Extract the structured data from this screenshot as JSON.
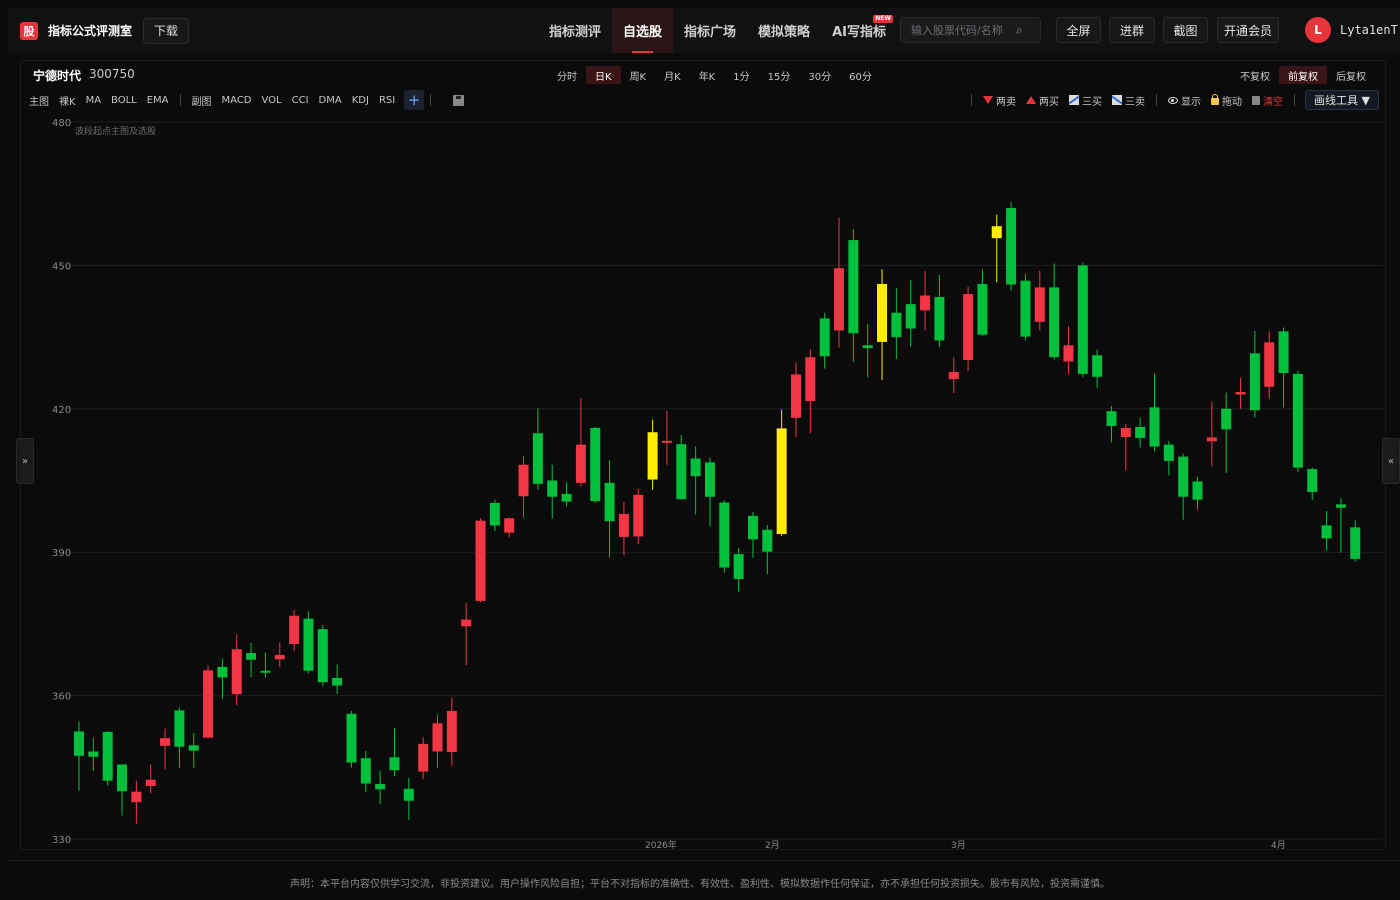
{
  "app": {
    "logo_char": "股",
    "title": "指标公式评测室",
    "download_label": "下载"
  },
  "nav": {
    "items": [
      {
        "label": "指标测评",
        "active": false
      },
      {
        "label": "自选股",
        "active": true
      },
      {
        "label": "指标广场",
        "active": false
      },
      {
        "label": "模拟策略",
        "active": false
      },
      {
        "label": "AI写指标",
        "active": false,
        "badge": "NEW"
      }
    ],
    "search_placeholder": "输入股票代码/名称",
    "buttons": {
      "fullscreen": "全屏",
      "join_group": "进群",
      "screenshot": "截图",
      "vip": "开通会员"
    },
    "avatar_letter": "L",
    "username": "Lyta1enT"
  },
  "stock": {
    "name": "宁德时代",
    "code": "300750"
  },
  "periods": [
    {
      "label": "分时",
      "active": false
    },
    {
      "label": "日K",
      "active": true
    },
    {
      "label": "周K",
      "active": false
    },
    {
      "label": "月K",
      "active": false
    },
    {
      "label": "年K",
      "active": false
    },
    {
      "label": "1分",
      "active": false
    },
    {
      "label": "15分",
      "active": false
    },
    {
      "label": "30分",
      "active": false
    },
    {
      "label": "60分",
      "active": false
    }
  ],
  "adjust": [
    {
      "label": "不复权",
      "active": false
    },
    {
      "label": "前复权",
      "active": true
    },
    {
      "label": "后复权",
      "active": false
    }
  ],
  "indicators_main": [
    "主图",
    "裸K",
    "MA",
    "BOLL",
    "EMA"
  ],
  "indicators_sub": [
    "副图",
    "MACD",
    "VOL",
    "CCI",
    "DMA",
    "KDJ",
    "RSI"
  ],
  "plus_label": "+",
  "draw_tools": {
    "sell2": "两卖",
    "buy2": "两买",
    "buy3": "三买",
    "sell3": "三卖",
    "show": "显示",
    "drag": "拖动",
    "clear": "清空",
    "menu": "画线工具 ▼"
  },
  "side_left": "»",
  "side_right": "«",
  "chart_data": {
    "type": "candlestick",
    "annotation": "波段起点主图及选股",
    "ylim": [
      330,
      480
    ],
    "yticks": [
      330,
      360,
      390,
      420,
      450,
      480
    ],
    "xticks": [
      "2026年",
      "2月",
      "3月",
      "4月"
    ],
    "colors": {
      "up": "#f23645",
      "down": "#00c03c",
      "signal": "#ffee00",
      "grid": "#1f1f22",
      "axis_text": "#8a8a8e"
    },
    "candles": [
      {
        "o": 352.5,
        "c": 347.4,
        "h": 354.6,
        "l": 340.1,
        "kind": "down"
      },
      {
        "o": 348.3,
        "c": 347.2,
        "h": 351.2,
        "l": 344.2,
        "kind": "down"
      },
      {
        "o": 352.4,
        "c": 342.2,
        "h": 352.6,
        "l": 341.2,
        "kind": "down"
      },
      {
        "o": 345.6,
        "c": 340.0,
        "h": 345.6,
        "l": 334.9,
        "kind": "down"
      },
      {
        "o": 337.7,
        "c": 339.9,
        "h": 342.2,
        "l": 333.2,
        "kind": "up"
      },
      {
        "o": 341.1,
        "c": 342.4,
        "h": 345.6,
        "l": 339.6,
        "kind": "up"
      },
      {
        "o": 349.5,
        "c": 351.1,
        "h": 353.1,
        "l": 344.6,
        "kind": "up"
      },
      {
        "o": 356.9,
        "c": 349.3,
        "h": 357.5,
        "l": 344.9,
        "kind": "down"
      },
      {
        "o": 349.6,
        "c": 348.5,
        "h": 352.2,
        "l": 344.9,
        "kind": "down"
      },
      {
        "o": 351.2,
        "c": 365.3,
        "h": 366.3,
        "l": 351.1,
        "kind": "up"
      },
      {
        "o": 366.0,
        "c": 363.8,
        "h": 367.7,
        "l": 359.3,
        "kind": "down"
      },
      {
        "o": 360.3,
        "c": 369.7,
        "h": 372.8,
        "l": 358.0,
        "kind": "up"
      },
      {
        "o": 368.9,
        "c": 367.5,
        "h": 371.0,
        "l": 363.9,
        "kind": "down"
      },
      {
        "o": 365.2,
        "c": 364.9,
        "h": 369.0,
        "l": 363.8,
        "kind": "down"
      },
      {
        "o": 367.6,
        "c": 368.5,
        "h": 371.1,
        "l": 366.0,
        "kind": "up"
      },
      {
        "o": 370.8,
        "c": 376.7,
        "h": 377.9,
        "l": 369.3,
        "kind": "up"
      },
      {
        "o": 376.1,
        "c": 365.2,
        "h": 377.6,
        "l": 364.6,
        "kind": "down"
      },
      {
        "o": 373.9,
        "c": 362.8,
        "h": 374.8,
        "l": 362.0,
        "kind": "down"
      },
      {
        "o": 363.7,
        "c": 362.1,
        "h": 366.5,
        "l": 360.3,
        "kind": "down"
      },
      {
        "o": 356.2,
        "c": 346.0,
        "h": 356.8,
        "l": 345.0,
        "kind": "down"
      },
      {
        "o": 346.9,
        "c": 341.6,
        "h": 348.4,
        "l": 339.8,
        "kind": "down"
      },
      {
        "o": 341.5,
        "c": 340.4,
        "h": 344.3,
        "l": 337.3,
        "kind": "down"
      },
      {
        "o": 347.1,
        "c": 344.4,
        "h": 353.2,
        "l": 343.1,
        "kind": "down"
      },
      {
        "o": 340.5,
        "c": 338.0,
        "h": 342.8,
        "l": 334.0,
        "kind": "down"
      },
      {
        "o": 344.1,
        "c": 349.9,
        "h": 351.3,
        "l": 342.5,
        "kind": "up"
      },
      {
        "o": 348.3,
        "c": 354.2,
        "h": 356.0,
        "l": 344.8,
        "kind": "up"
      },
      {
        "o": 348.2,
        "c": 356.8,
        "h": 359.5,
        "l": 345.3,
        "kind": "up"
      },
      {
        "o": 374.5,
        "c": 375.9,
        "h": 379.4,
        "l": 366.4,
        "kind": "up"
      },
      {
        "o": 379.8,
        "c": 396.6,
        "h": 397.1,
        "l": 379.5,
        "kind": "up"
      },
      {
        "o": 400.3,
        "c": 395.6,
        "h": 401.0,
        "l": 394.4,
        "kind": "down"
      },
      {
        "o": 394.1,
        "c": 397.1,
        "h": 397.3,
        "l": 393.2,
        "kind": "up"
      },
      {
        "o": 401.7,
        "c": 408.3,
        "h": 410.1,
        "l": 397.2,
        "kind": "up"
      },
      {
        "o": 414.9,
        "c": 404.3,
        "h": 420.1,
        "l": 403.1,
        "kind": "down"
      },
      {
        "o": 405.0,
        "c": 401.6,
        "h": 408.3,
        "l": 397.0,
        "kind": "down"
      },
      {
        "o": 402.2,
        "c": 400.6,
        "h": 404.6,
        "l": 399.6,
        "kind": "down"
      },
      {
        "o": 404.5,
        "c": 412.5,
        "h": 422.2,
        "l": 403.8,
        "kind": "up"
      },
      {
        "o": 416.0,
        "c": 400.7,
        "h": 416.2,
        "l": 400.3,
        "kind": "down"
      },
      {
        "o": 404.5,
        "c": 396.5,
        "h": 409.2,
        "l": 388.9,
        "kind": "down"
      },
      {
        "o": 393.2,
        "c": 398.0,
        "h": 400.5,
        "l": 389.4,
        "kind": "up"
      },
      {
        "o": 393.3,
        "c": 402.0,
        "h": 403.3,
        "l": 391.7,
        "kind": "up"
      },
      {
        "o": 415.1,
        "c": 405.2,
        "h": 417.7,
        "l": 403.1,
        "kind": "signal"
      },
      {
        "o": 413.1,
        "c": 413.3,
        "h": 419.6,
        "l": 408.3,
        "kind": "up"
      },
      {
        "o": 412.6,
        "c": 401.1,
        "h": 414.5,
        "l": 401.0,
        "kind": "down"
      },
      {
        "o": 409.6,
        "c": 405.9,
        "h": 412.1,
        "l": 397.9,
        "kind": "down"
      },
      {
        "o": 408.8,
        "c": 401.6,
        "h": 409.8,
        "l": 395.4,
        "kind": "down"
      },
      {
        "o": 400.4,
        "c": 386.8,
        "h": 400.9,
        "l": 385.7,
        "kind": "down"
      },
      {
        "o": 389.6,
        "c": 384.4,
        "h": 390.9,
        "l": 381.8,
        "kind": "down"
      },
      {
        "o": 397.6,
        "c": 392.7,
        "h": 398.4,
        "l": 388.8,
        "kind": "down"
      },
      {
        "o": 394.7,
        "c": 390.1,
        "h": 395.7,
        "l": 385.4,
        "kind": "down"
      },
      {
        "o": 393.8,
        "c": 415.9,
        "h": 419.8,
        "l": 393.4,
        "kind": "signal"
      },
      {
        "o": 418.1,
        "c": 427.2,
        "h": 429.7,
        "l": 414.1,
        "kind": "up"
      },
      {
        "o": 421.6,
        "c": 430.8,
        "h": 432.5,
        "l": 414.9,
        "kind": "up"
      },
      {
        "o": 431.0,
        "c": 438.9,
        "h": 440.1,
        "l": 428.4,
        "kind": "down"
      },
      {
        "o": 436.4,
        "c": 449.4,
        "h": 460.0,
        "l": 432.8,
        "kind": "up"
      },
      {
        "o": 435.8,
        "c": 455.3,
        "h": 457.6,
        "l": 429.8,
        "kind": "down"
      },
      {
        "o": 432.7,
        "c": 433.3,
        "h": 437.8,
        "l": 426.6,
        "kind": "down"
      },
      {
        "o": 434.0,
        "c": 446.1,
        "h": 449.2,
        "l": 426.0,
        "kind": "signal"
      },
      {
        "o": 435.0,
        "c": 440.1,
        "h": 445.3,
        "l": 430.4,
        "kind": "down"
      },
      {
        "o": 436.8,
        "c": 441.9,
        "h": 447.0,
        "l": 433.0,
        "kind": "down"
      },
      {
        "o": 440.6,
        "c": 443.7,
        "h": 448.8,
        "l": 436.4,
        "kind": "up"
      },
      {
        "o": 434.3,
        "c": 443.4,
        "h": 448.0,
        "l": 432.9,
        "kind": "down"
      },
      {
        "o": 426.2,
        "c": 427.7,
        "h": 430.7,
        "l": 423.3,
        "kind": "up"
      },
      {
        "o": 430.2,
        "c": 444.0,
        "h": 445.5,
        "l": 427.9,
        "kind": "up"
      },
      {
        "o": 435.5,
        "c": 446.1,
        "h": 449.2,
        "l": 435.2,
        "kind": "down"
      },
      {
        "o": 458.2,
        "c": 455.7,
        "h": 460.6,
        "l": 446.5,
        "kind": "signal"
      },
      {
        "o": 462.0,
        "c": 446.0,
        "h": 463.3,
        "l": 444.7,
        "kind": "down"
      },
      {
        "o": 446.8,
        "c": 435.1,
        "h": 448.2,
        "l": 434.3,
        "kind": "down"
      },
      {
        "o": 438.2,
        "c": 445.4,
        "h": 448.9,
        "l": 436.4,
        "kind": "up"
      },
      {
        "o": 445.4,
        "c": 430.8,
        "h": 450.4,
        "l": 430.3,
        "kind": "down"
      },
      {
        "o": 429.9,
        "c": 433.3,
        "h": 437.3,
        "l": 427.3,
        "kind": "up"
      },
      {
        "o": 450.0,
        "c": 427.3,
        "h": 450.6,
        "l": 426.7,
        "kind": "down"
      },
      {
        "o": 431.2,
        "c": 426.7,
        "h": 432.4,
        "l": 424.4,
        "kind": "down"
      },
      {
        "o": 419.5,
        "c": 416.4,
        "h": 420.6,
        "l": 413.0,
        "kind": "down"
      },
      {
        "o": 414.1,
        "c": 416.0,
        "h": 416.9,
        "l": 407.1,
        "kind": "up"
      },
      {
        "o": 416.2,
        "c": 413.9,
        "h": 418.1,
        "l": 411.9,
        "kind": "down"
      },
      {
        "o": 420.3,
        "c": 412.1,
        "h": 427.4,
        "l": 411.1,
        "kind": "down"
      },
      {
        "o": 412.5,
        "c": 409.1,
        "h": 413.3,
        "l": 406.1,
        "kind": "down"
      },
      {
        "o": 410.0,
        "c": 401.6,
        "h": 410.6,
        "l": 396.8,
        "kind": "down"
      },
      {
        "o": 404.8,
        "c": 401.0,
        "h": 405.8,
        "l": 398.9,
        "kind": "down"
      },
      {
        "o": 413.2,
        "c": 414.0,
        "h": 421.5,
        "l": 408.0,
        "kind": "up"
      },
      {
        "o": 420.0,
        "c": 415.7,
        "h": 423.4,
        "l": 406.6,
        "kind": "down"
      },
      {
        "o": 423.0,
        "c": 423.5,
        "h": 426.5,
        "l": 420.0,
        "kind": "up"
      },
      {
        "o": 431.6,
        "c": 419.7,
        "h": 436.3,
        "l": 418.2,
        "kind": "down"
      },
      {
        "o": 424.6,
        "c": 433.9,
        "h": 436.2,
        "l": 422.0,
        "kind": "up"
      },
      {
        "o": 436.2,
        "c": 427.5,
        "h": 437.0,
        "l": 420.3,
        "kind": "down"
      },
      {
        "o": 427.3,
        "c": 407.7,
        "h": 428.0,
        "l": 406.8,
        "kind": "down"
      },
      {
        "o": 407.4,
        "c": 402.6,
        "h": 407.7,
        "l": 400.9,
        "kind": "down"
      },
      {
        "o": 395.6,
        "c": 392.9,
        "h": 398.6,
        "l": 390.4,
        "kind": "down"
      },
      {
        "o": 400.0,
        "c": 399.3,
        "h": 401.3,
        "l": 389.9,
        "kind": "down"
      },
      {
        "o": 395.2,
        "c": 388.6,
        "h": 396.7,
        "l": 388.0,
        "kind": "down"
      }
    ]
  },
  "disclaimer": "声明：本平台内容仅供学习交流，非投资建议。用户操作风险自担；平台不对指标的准确性、有效性、盈利性、模拟数据作任何保证，亦不承担任何投资损失。股市有风险，投资需谨慎。"
}
